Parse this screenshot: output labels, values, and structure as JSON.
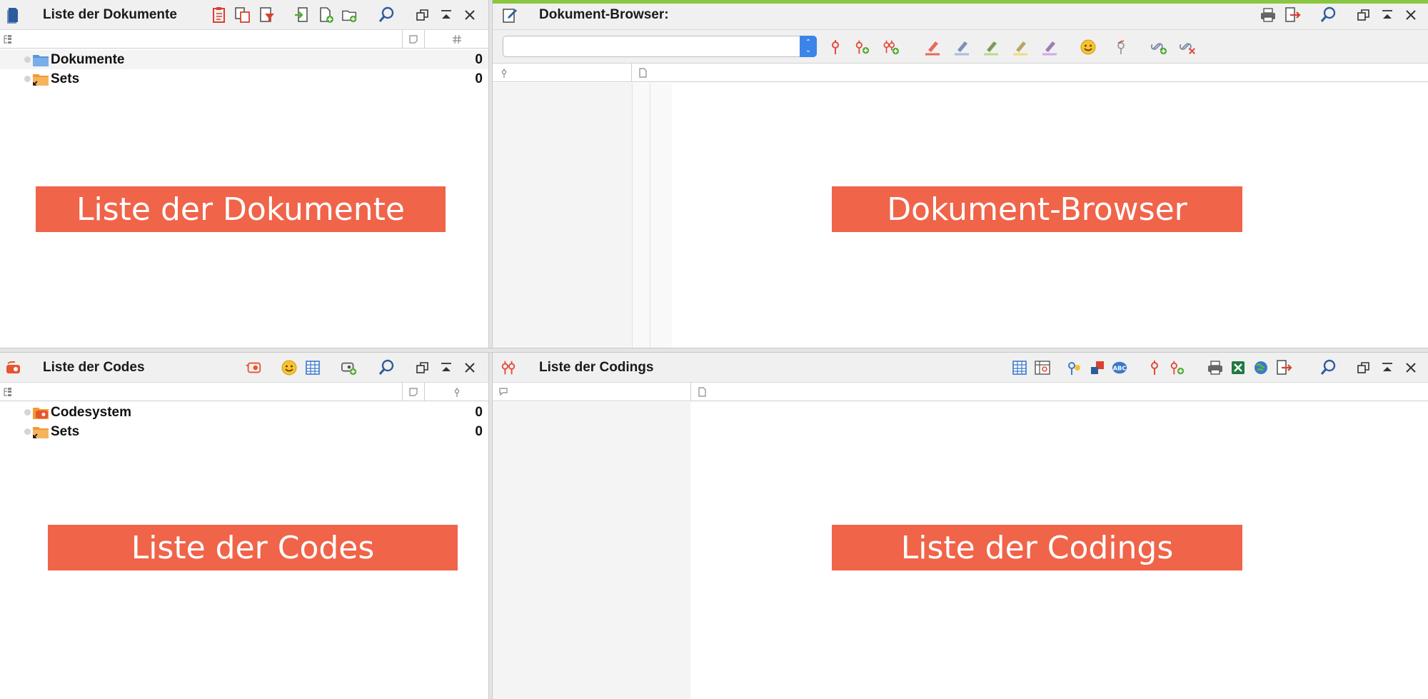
{
  "colors": {
    "banner": "#f0644a",
    "green_line": "#8ac640",
    "titlebar_bg": "#f0f0f0",
    "folder_blue": "#5b93d9",
    "folder_orange": "#f7a547",
    "stepper_blue": "#3d84e8"
  },
  "documents_pane": {
    "title": "Liste der Dokumente",
    "app_icon": "document-system-icon",
    "toolbar_icons": [
      "new-document-clipboard-icon",
      "documents-copy-icon",
      "document-filter-icon",
      "import-icon",
      "new-document-icon",
      "new-document-group-icon",
      "search-icon",
      "undock-icon",
      "maximize-icon",
      "close-icon"
    ],
    "column_icons": [
      "tree-icon",
      "memo-icon",
      "hash-icon"
    ],
    "rows": [
      {
        "label": "Dokumente",
        "count": "0",
        "folder": "blue-folder-icon"
      },
      {
        "label": "Sets",
        "count": "0",
        "folder": "set-folder-icon"
      }
    ],
    "banner": "Liste der Dokumente"
  },
  "browser_pane": {
    "title": "Dokument-Browser:",
    "app_icon": "edit-document-icon",
    "combo_value": "",
    "toolbar_icons": [
      "print-icon",
      "export-icon",
      "search-icon",
      "undock-icon",
      "maximize-icon",
      "close-icon"
    ],
    "tool_icons": [
      "code-icon",
      "code-add-icon",
      "code-multiple-icon",
      "highlight-red-icon",
      "highlight-blue-icon",
      "highlight-green-icon",
      "highlight-yellow-icon",
      "highlight-purple-icon",
      "emoticon-icon",
      "code-remove-icon",
      "link-add-icon",
      "link-remove-icon"
    ],
    "column_icons": [
      "code-column-icon",
      "document-column-icon"
    ],
    "banner": "Dokument-Browser"
  },
  "codes_pane": {
    "title": "Liste der Codes",
    "app_icon": "code-system-icon",
    "toolbar_icons": [
      "code-favorites-icon",
      "emoticon-icon",
      "table-icon",
      "new-code-icon",
      "search-icon",
      "undock-icon",
      "maximize-icon",
      "close-icon"
    ],
    "column_icons": [
      "tree-icon",
      "memo-icon",
      "code-icon"
    ],
    "rows": [
      {
        "label": "Codesystem",
        "count": "0",
        "folder": "code-system-folder-icon"
      },
      {
        "label": "Sets",
        "count": "0",
        "folder": "set-folder-icon"
      }
    ],
    "banner": "Liste der Codes"
  },
  "codings_pane": {
    "title": "Liste der Codings",
    "app_icon": "codings-icon",
    "toolbar_icons": [
      "table-icon",
      "code-matrix-icon",
      "idea-icon",
      "shapes-icon",
      "abc-icon",
      "code-icon",
      "code-add-icon",
      "print-icon",
      "excel-icon",
      "web-icon",
      "export-icon",
      "search-icon",
      "undock-icon",
      "maximize-icon",
      "close-icon"
    ],
    "column_icons": [
      "comment-column-icon",
      "document-column-icon"
    ],
    "banner": "Liste der Codings"
  }
}
